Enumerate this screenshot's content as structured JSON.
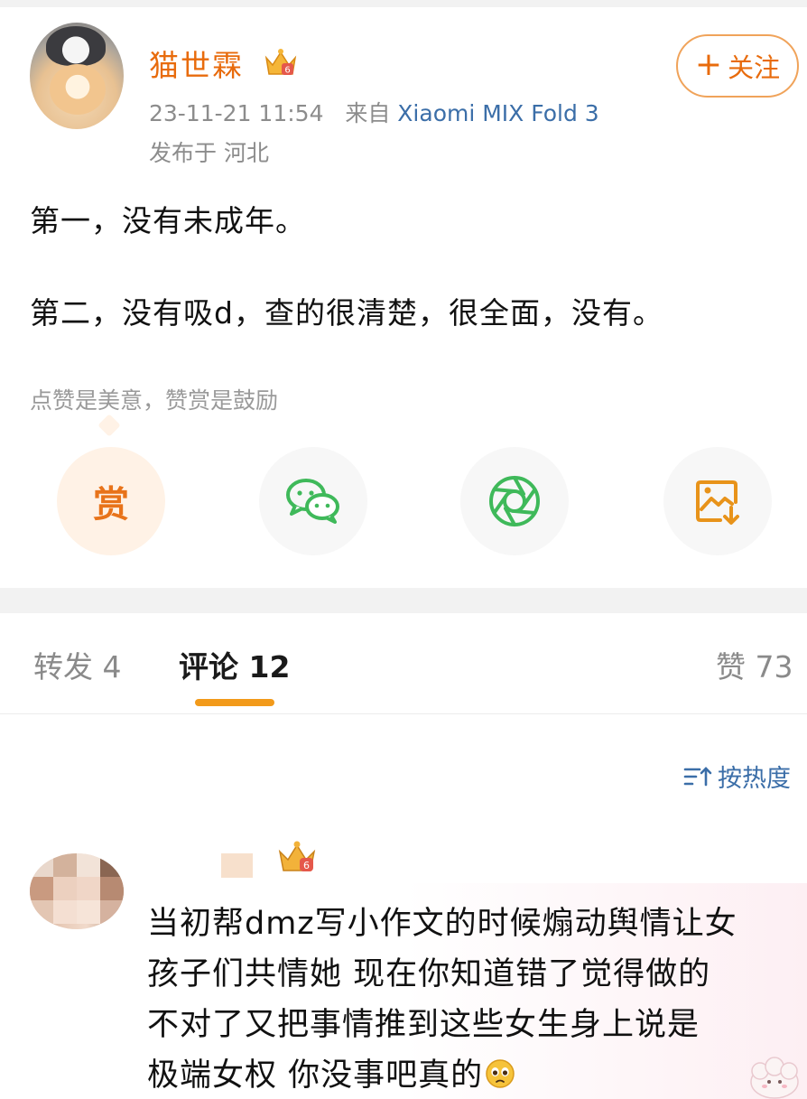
{
  "post": {
    "author": "猫世霖",
    "timestamp": "23-11-21 11:54",
    "source_prefix": "来自",
    "device": "Xiaomi MIX Fold 3",
    "location": "发布于 河北",
    "follow_plus": "+",
    "follow_label": "关注",
    "lines": [
      "第一，没有未成年。",
      "第二，没有吸d，查的很清楚，很全面，没有。"
    ],
    "tip": "点赞是美意，赞赏是鼓励",
    "reward_label": "赏"
  },
  "icons": {
    "follow": "plus-icon",
    "wechat": "wechat-icon",
    "moments": "moments-icon",
    "save": "save-image-icon",
    "sort": "sort-icon",
    "crown": "crown-badge-icon"
  },
  "tabs": {
    "repost": "转发 4",
    "comments": "评论 12",
    "likes": "赞 73"
  },
  "sort_label": "按热度",
  "comment": {
    "lines": [
      "当初帮dmz写小作文的时候煽动舆情让女",
      "孩子们共情她 现在你知道错了觉得做的",
      "不对了又把事情推到这些女生身上说是",
      "极端女权 你没事吧真的"
    ]
  },
  "colors": {
    "accent_orange": "#e86b0c",
    "link_blue": "#3b6ea8",
    "wechat_green": "#3fb95a",
    "tab_underline": "#f29a1a"
  }
}
